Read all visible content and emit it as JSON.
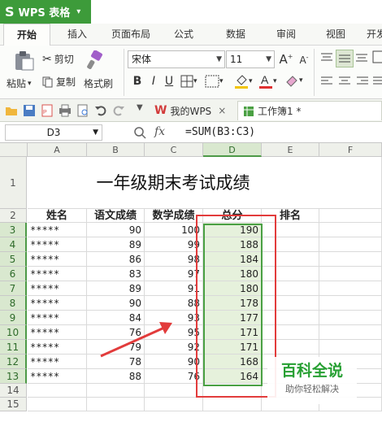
{
  "app": {
    "title": "WPS 表格"
  },
  "tabs": [
    "开始",
    "插入",
    "页面布局",
    "公式",
    "数据",
    "审阅",
    "视图",
    "开发"
  ],
  "ribbon": {
    "paste": "粘贴",
    "cut": "剪切",
    "copy": "复制",
    "format_painter": "格式刷",
    "font_name": "宋体",
    "font_size": "11"
  },
  "doc_tabs": [
    {
      "label": "我的WPS"
    },
    {
      "label": "工作簿1 *"
    }
  ],
  "formula_bar": {
    "cell_ref": "D3",
    "fx": "fx",
    "formula": "=SUM(B3:C3)"
  },
  "sheet": {
    "columns": [
      "A",
      "B",
      "C",
      "D",
      "E",
      "F"
    ],
    "rows": [
      "1",
      "2",
      "3",
      "4",
      "5",
      "6",
      "7",
      "8",
      "9",
      "10",
      "11",
      "12",
      "13",
      "14",
      "15"
    ],
    "title": "一年级期末考试成绩",
    "headers": [
      "姓名",
      "语文成绩",
      "数学成绩",
      "总分",
      "排名"
    ],
    "data": [
      [
        "*****",
        "90",
        "100",
        "190"
      ],
      [
        "*****",
        "89",
        "99",
        "188"
      ],
      [
        "*****",
        "86",
        "98",
        "184"
      ],
      [
        "*****",
        "83",
        "97",
        "180"
      ],
      [
        "*****",
        "89",
        "91",
        "180"
      ],
      [
        "*****",
        "90",
        "88",
        "178"
      ],
      [
        "*****",
        "84",
        "93",
        "177"
      ],
      [
        "*****",
        "76",
        "95",
        "171"
      ],
      [
        "*****",
        "79",
        "92",
        "171"
      ],
      [
        "*****",
        "78",
        "90",
        "168"
      ],
      [
        "*****",
        "88",
        "76",
        "164"
      ]
    ]
  },
  "watermark": {
    "main": "百科全说",
    "sub": "助你轻松解决"
  },
  "colors": {
    "accent": "#3d9b3a",
    "selection": "#e6f1dc",
    "annotation": "#e23c3c"
  }
}
